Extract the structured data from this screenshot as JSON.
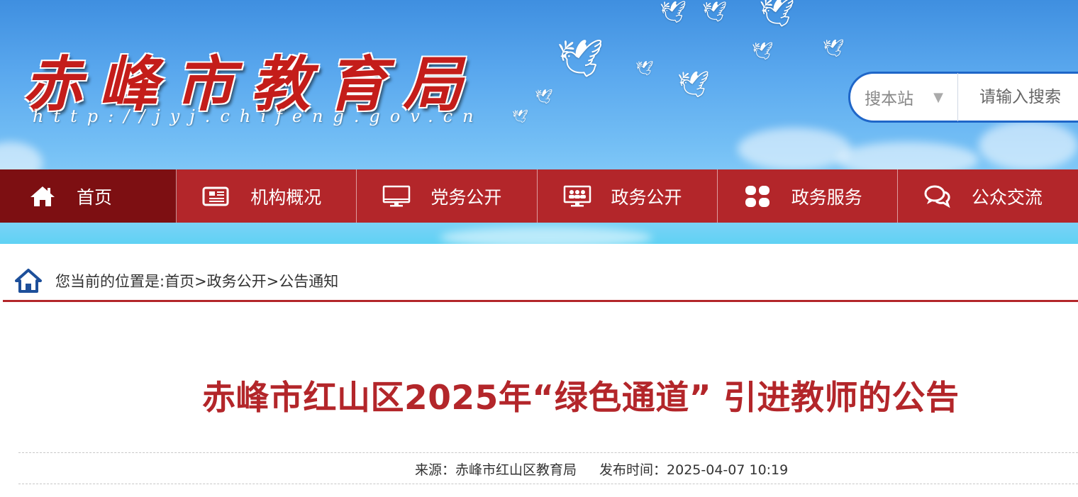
{
  "header": {
    "logo_chars": [
      "赤",
      "峰",
      "市",
      "教",
      "育",
      "局"
    ],
    "logo_url": "http://jyj.chifeng.gov.cn",
    "search": {
      "scope_label": "搜本站",
      "scope_arrow": "▼",
      "placeholder": "请输入搜索"
    }
  },
  "nav": {
    "items": [
      {
        "label": "首页",
        "icon": "home-icon",
        "active": true
      },
      {
        "label": "机构概况",
        "icon": "newspaper-icon",
        "active": false
      },
      {
        "label": "党务公开",
        "icon": "monitor-icon",
        "active": false
      },
      {
        "label": "政务公开",
        "icon": "people-screen-icon",
        "active": false
      },
      {
        "label": "政务服务",
        "icon": "grid-tiles-icon",
        "active": false
      },
      {
        "label": "公众交流",
        "icon": "chat-bubbles-icon",
        "active": false
      }
    ]
  },
  "breadcrumb": {
    "text": "您当前的位置是:首页>政务公开>公告通知"
  },
  "article": {
    "title": "赤峰市红山区2025年“绿色通道” 引进教师的公告",
    "source": "来源：赤峰市红山区教育局",
    "publish_time": "发布时间：2025-04-07 10:19"
  },
  "colors": {
    "brand_red": "#b3262a",
    "nav_active": "#7d0f12",
    "search_border": "#1f66c8"
  }
}
